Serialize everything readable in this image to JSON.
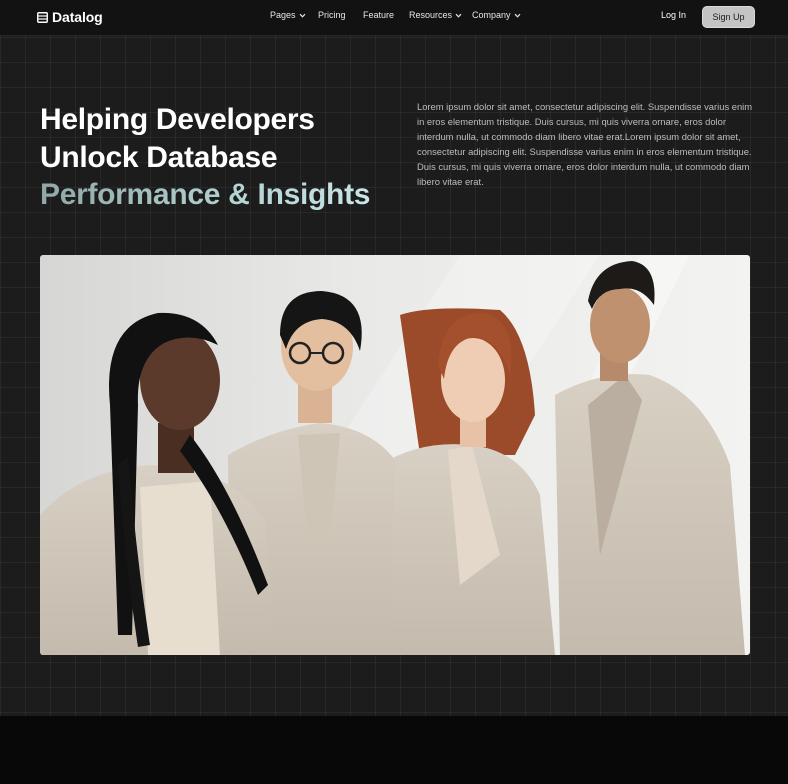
{
  "nav": {
    "brand": "Datalog",
    "brand_icon": "database-table-icon",
    "links": [
      {
        "label": "Pages",
        "has_dropdown": true
      },
      {
        "label": "Pricing",
        "has_dropdown": false
      },
      {
        "label": "Feature",
        "has_dropdown": false
      },
      {
        "label": "Resources",
        "has_dropdown": true
      },
      {
        "label": "Company",
        "has_dropdown": true
      }
    ],
    "login_label": "Log In",
    "signup_label": "Sign Up"
  },
  "hero": {
    "headline_line1": "Helping Developers",
    "headline_line2": "Unlock Database",
    "headline_line3": "Performance & Insights",
    "description": "Lorem ipsum dolor sit amet, consectetur adipiscing elit. Suspendisse varius enim in eros elementum tristique. Duis cursus, mi quis viverra ornare, eros dolor interdum nulla, ut commodo diam libero vitae erat.Lorem ipsum dolor sit amet, consectetur adipiscing elit. Suspendisse varius enim in eros elementum tristique. Duis cursus, mi quis viverra ornare, eros dolor interdum nulla, ut commodo diam libero vitae erat."
  },
  "colors": {
    "background": "#1c1c1c",
    "nav_background": "#121212",
    "accent_gradient_start": "#8fa8a6",
    "accent_gradient_end": "#cfeaea",
    "signup_button": "#c4c4c4"
  }
}
